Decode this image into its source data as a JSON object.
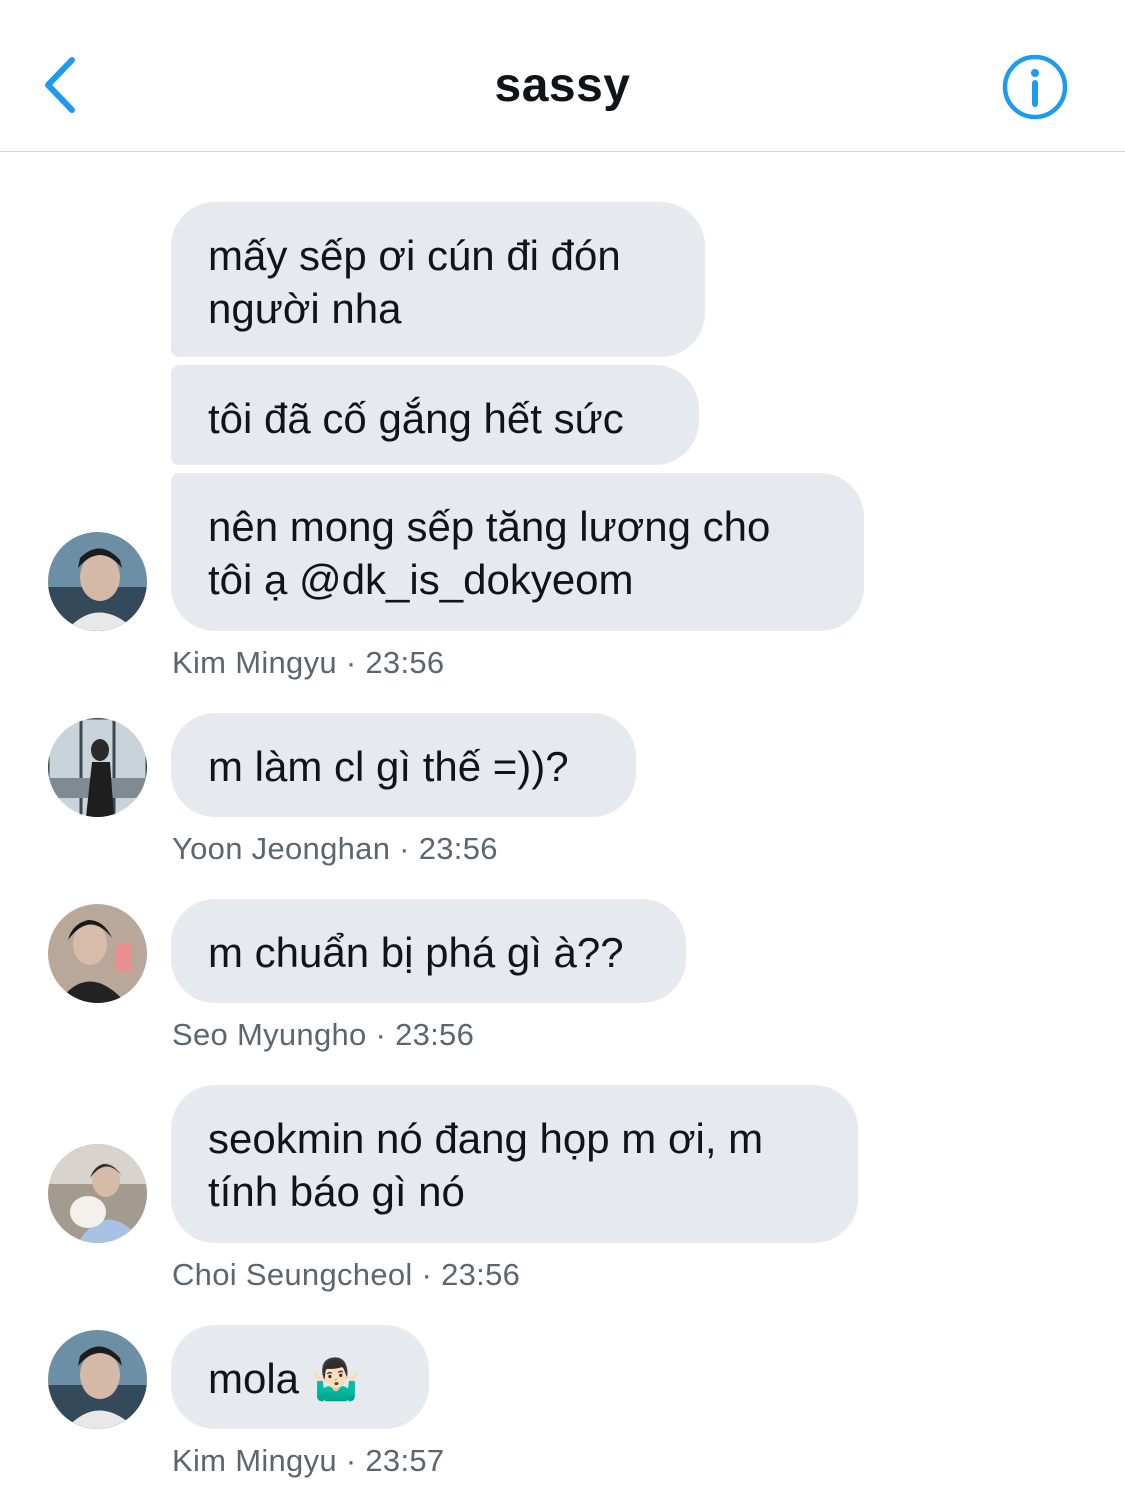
{
  "header": {
    "title": "sassy"
  },
  "messages": [
    {
      "texts": [
        "mấy sếp ơi cún đi đón người nha",
        "tôi đã cố gắng hết sức",
        "nên mong sếp tăng lương cho tôi ạ @dk_is_dokyeom"
      ],
      "author": "Kim Mingyu",
      "time": "23:56"
    },
    {
      "texts": [
        "m làm cl gì thế =))?"
      ],
      "author": "Yoon Jeonghan",
      "time": "23:56"
    },
    {
      "texts": [
        "m chuẩn bị phá gì à??"
      ],
      "author": "Seo Myungho",
      "time": "23:56"
    },
    {
      "texts": [
        "seokmin nó đang họp m ơi, m tính báo gì nó"
      ],
      "author": "Choi Seungcheol",
      "time": "23:56"
    },
    {
      "texts": [
        "mola"
      ],
      "emoji": "🤷🏻‍♂️",
      "author": "Kim Mingyu",
      "time": "23:57"
    }
  ],
  "meta_separator": " · ",
  "colors": {
    "accent": "#1d9bf0",
    "bubble": "#e6eaef",
    "meta": "#5b6670"
  },
  "icons": {
    "back": "chevron-left-icon",
    "info": "info-circle-icon"
  }
}
